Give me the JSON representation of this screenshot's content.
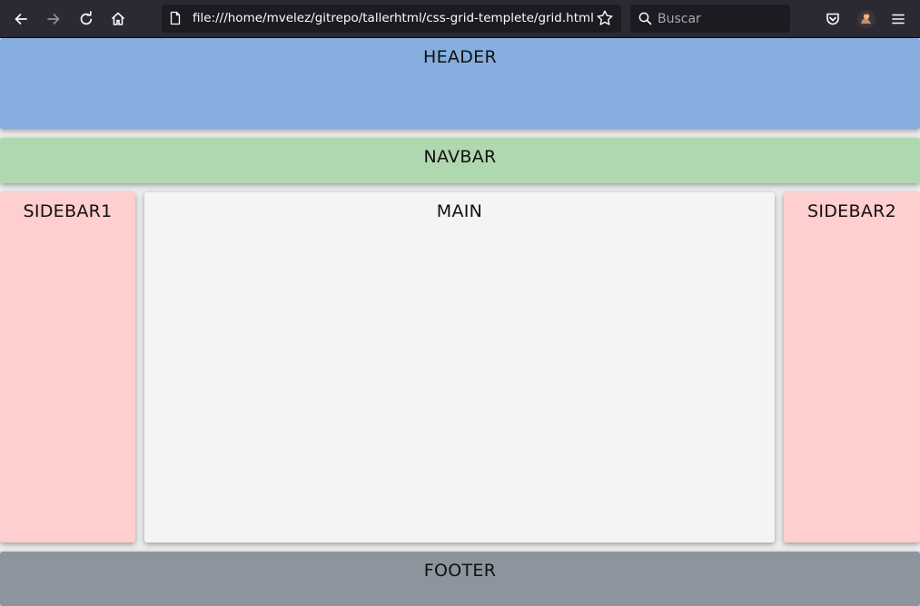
{
  "browser": {
    "url": "file:///home/mvelez/gitrepo/tallerhtml/css-grid-templete/grid.html",
    "search_placeholder": "Buscar",
    "icons": [
      "back-arrow-icon",
      "forward-arrow-icon",
      "reload-icon",
      "home-icon",
      "page-icon",
      "bookmark-star-icon",
      "search-icon",
      "pocket-icon",
      "profile-avatar-icon",
      "hamburger-menu-icon"
    ],
    "toolbar_color": "#2b2a33",
    "field_color": "#1c1b22"
  },
  "page": {
    "header": "HEADER",
    "navbar": "NAVBAR",
    "sidebar1": "SIDEBAR1",
    "main": "MAIN",
    "sidebar2": "SIDEBAR2",
    "footer": "FOOTER"
  },
  "colors": {
    "header": "#86aedf",
    "navbar": "#b0d8b0",
    "sidebar": "#ffcece",
    "main": "#f4f4f4",
    "footer": "#8c959e"
  }
}
